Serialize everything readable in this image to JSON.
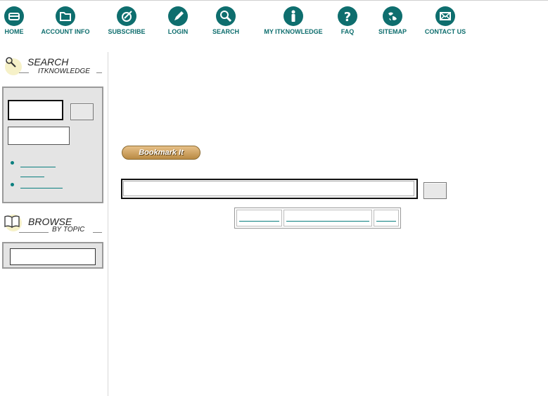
{
  "nav": {
    "items": [
      {
        "label": "HOME",
        "icon": "home-icon"
      },
      {
        "label": "ACCOUNT INFO",
        "icon": "folder-icon"
      },
      {
        "label": "SUBSCRIBE",
        "icon": "subscribe-icon"
      },
      {
        "label": "LOGIN",
        "icon": "pencil-icon"
      },
      {
        "label": "SEARCH",
        "icon": "magnifier-icon"
      },
      {
        "label": "MY ITKNOWLEDGE",
        "icon": "info-icon"
      },
      {
        "label": "FAQ",
        "icon": "question-icon"
      },
      {
        "label": "SITEMAP",
        "icon": "globe-icon"
      },
      {
        "label": "CONTACT US",
        "icon": "envelope-icon"
      }
    ],
    "color": "#0e6e6e"
  },
  "sidebar": {
    "search": {
      "title": "SEARCH",
      "subtitle": "ITKNOWLEDGE",
      "query_value": "",
      "second_value": "",
      "links": [
        "",
        ""
      ]
    },
    "browse": {
      "title": "BROWSE",
      "subtitle": "BY TOPIC",
      "select_value": ""
    }
  },
  "main": {
    "bookmark_label": "Bookmark It",
    "search_value": "",
    "link_cells": [
      "",
      "",
      ""
    ]
  }
}
